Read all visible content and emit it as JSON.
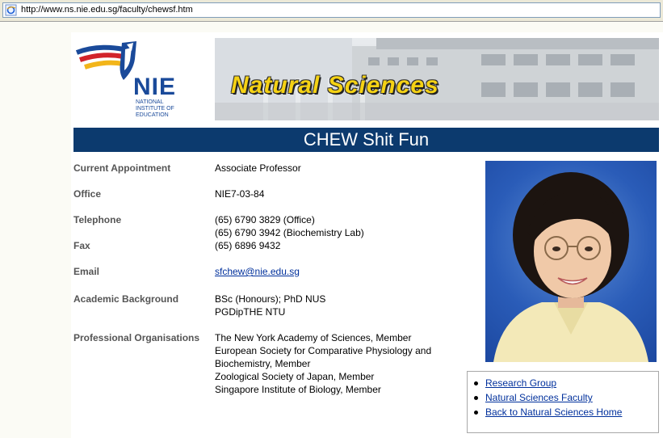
{
  "browser": {
    "url": "http://www.ns.nie.edu.sg/faculty/chewsf.htm"
  },
  "logo": {
    "acronym": "NIE",
    "line1": "NATIONAL",
    "line2": "INSTITUTE OF",
    "line3": "EDUCATION"
  },
  "banner": {
    "title": "Natural Sciences"
  },
  "page": {
    "name": "CHEW Shit Fun"
  },
  "profile": {
    "appointment_label": "Current Appointment",
    "appointment_value": "Associate Professor",
    "office_label": "Office",
    "office_value": "NIE7-03-84",
    "telephone_label": "Telephone",
    "telephone_line1": "(65) 6790 3829 (Office)",
    "telephone_line2": "(65) 6790 3942 (Biochemistry Lab)",
    "fax_label": "Fax",
    "fax_value": "(65) 6896 9432",
    "email_label": "Email",
    "email_value": "sfchew@nie.edu.sg",
    "academic_label": "Academic Background",
    "academic_line1": "BSc (Honours); PhD NUS",
    "academic_line2": "PGDipTHE NTU",
    "orgs_label": "Professional Organisations",
    "orgs": [
      "The New York Academy of Sciences, Member",
      "European Society for Comparative Physiology and",
      "Biochemistry, Member",
      "Zoological Society of Japan, Member",
      "Singapore Institute of Biology, Member"
    ]
  },
  "links": [
    "Research Group",
    "Natural Sciences Faculty",
    "Back to Natural Sciences Home"
  ]
}
